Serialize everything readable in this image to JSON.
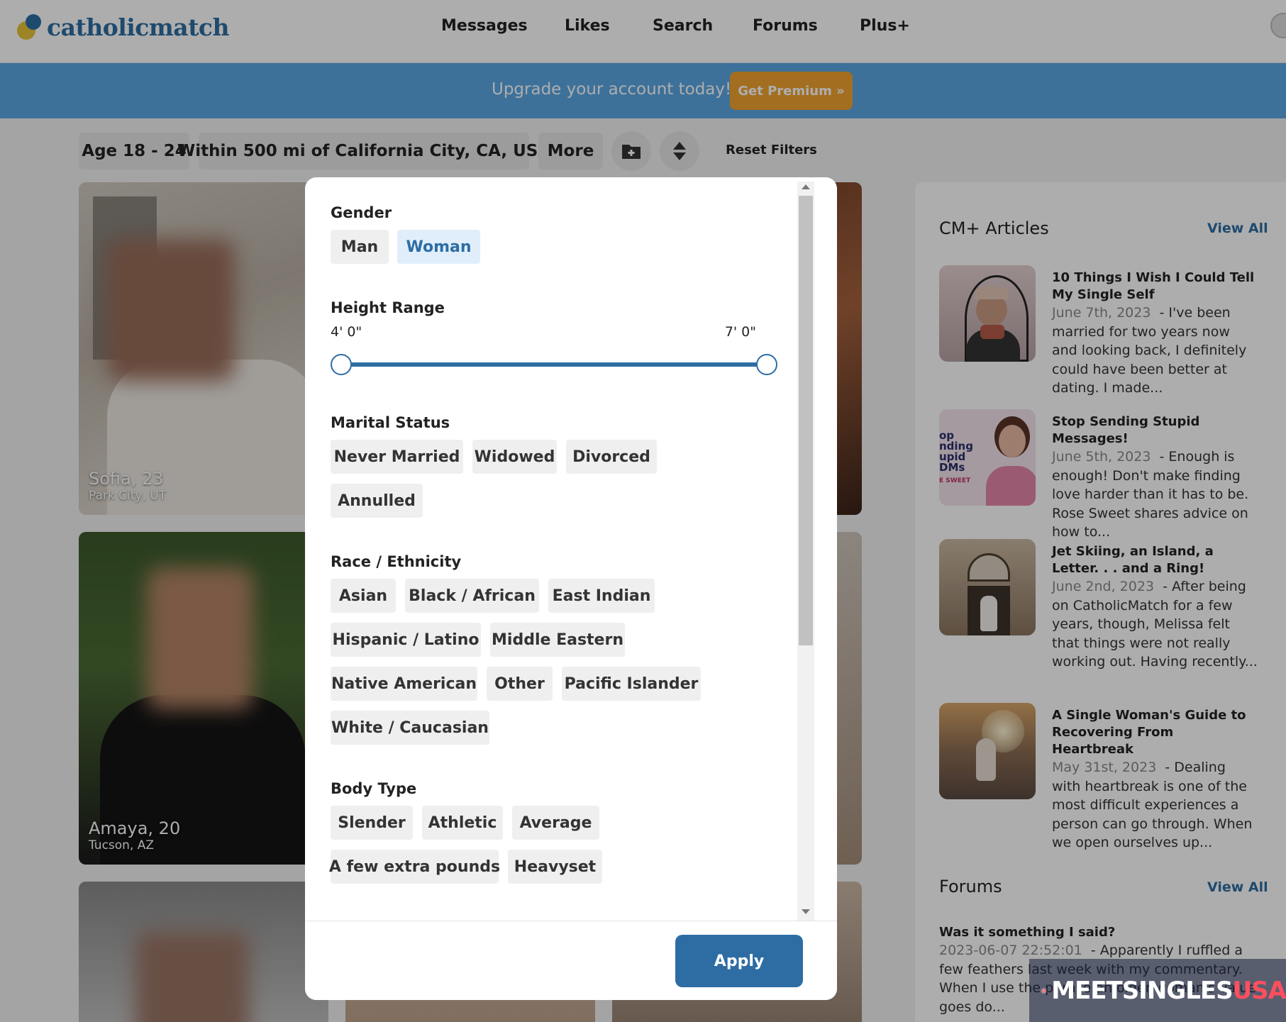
{
  "brand": {
    "name": "catholicmatch"
  },
  "nav": {
    "items": [
      "Messages",
      "Likes",
      "Search",
      "Forums",
      "Plus+"
    ]
  },
  "banner": {
    "text": "Upgrade your account today!",
    "button": "Get Premium »"
  },
  "filters": {
    "age": "Age 18 - 24",
    "location": "Within 500 mi of California City, CA, USA",
    "more": "More",
    "reset": "Reset Filters",
    "save_icon": "folder-plus-icon",
    "sort_icon": "sort-icon"
  },
  "profiles": [
    {
      "name": "Sofia, 23",
      "location": "Park City, UT"
    },
    {
      "name": "Amaya, 20",
      "location": "Tucson, AZ"
    }
  ],
  "sidebar": {
    "articles_title": "CM+ Articles",
    "view_all": "View All",
    "articles": [
      {
        "title": "10 Things I Wish I Could Tell My Single Self",
        "date": "June 7th, 2023",
        "excerpt": "I've been married for two years now and looking back, I definitely could have been better at dating. I made..."
      },
      {
        "title": "Stop Sending Stupid Messages!",
        "date": "June 5th, 2023",
        "excerpt": "Enough is enough! Don't make finding love harder than it has to be. Rose Sweet shares advice on how to..."
      },
      {
        "title": "Jet Skiing, an Island, a Letter. . . and a Ring!",
        "date": "June 2nd, 2023",
        "excerpt": "After being on CatholicMatch for a few years, though, Melissa felt that things were not really working out. Having recently..."
      },
      {
        "title": "A Single Woman's Guide to Recovering From Heartbreak",
        "date": "May 31st, 2023",
        "excerpt": "Dealing with heartbreak is one of the most difficult experiences a person can go through. When we open ourselves up..."
      }
    ],
    "thumb2_text": [
      "op",
      "nding",
      "upid DMs",
      "E SWEET"
    ],
    "forums_title": "Forums",
    "forums_view_all": "View All",
    "forum_post": {
      "title": "Was it something I said?",
      "date": "2023-06-07 22:52:01",
      "excerpt": "Apparently I ruffled a few feathers last week with my commentary. When I use the phrase an older woman's value goes do..."
    }
  },
  "modal": {
    "gender": {
      "label": "Gender",
      "options": [
        "Man",
        "Woman"
      ],
      "selected": "Woman"
    },
    "height": {
      "label": "Height Range",
      "min": "4' 0\"",
      "max": "7' 0\"",
      "range_fraction": [
        0,
        1
      ]
    },
    "marital": {
      "label": "Marital Status",
      "options": [
        "Never Married",
        "Widowed",
        "Divorced",
        "Annulled"
      ]
    },
    "race": {
      "label": "Race / Ethnicity",
      "options": [
        "Asian",
        "Black / African",
        "East Indian",
        "Hispanic / Latino",
        "Middle Eastern",
        "Native American",
        "Other",
        "Pacific Islander",
        "White / Caucasian"
      ]
    },
    "body": {
      "label": "Body Type",
      "options": [
        "Slender",
        "Athletic",
        "Average",
        "A few extra pounds",
        "Heavyset"
      ]
    },
    "apply": "Apply"
  },
  "watermark": {
    "text": "MEETSINGLES",
    "accent": "USA"
  },
  "colors": {
    "brand_blue": "#2d6da3",
    "banner": "#5aa7e3",
    "premium": "#f0a22e"
  }
}
